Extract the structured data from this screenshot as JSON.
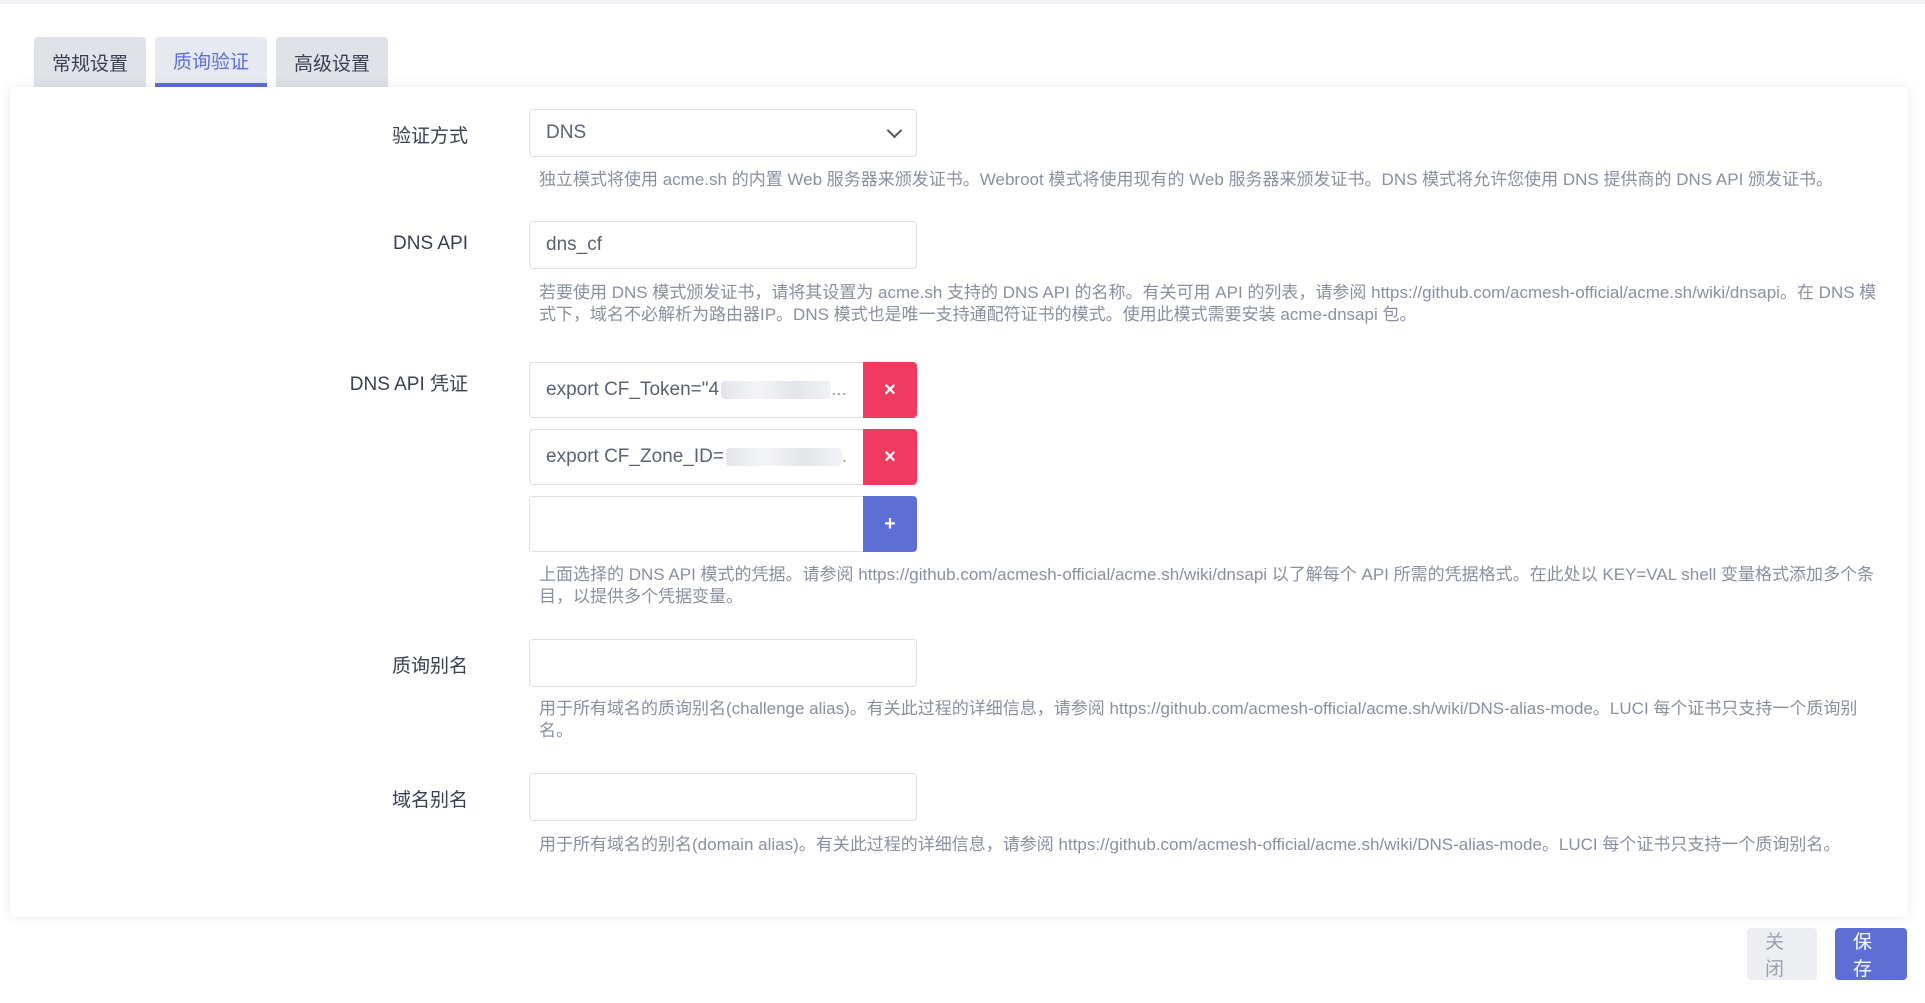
{
  "tabs": [
    {
      "label": "常规设置",
      "active": false
    },
    {
      "label": "质询验证",
      "active": true
    },
    {
      "label": "高级设置",
      "active": false
    }
  ],
  "form": {
    "validation_method": {
      "label": "验证方式",
      "value": "DNS",
      "help": "独立模式将使用 acme.sh 的内置 Web 服务器来颁发证书。Webroot 模式将使用现有的 Web 服务器来颁发证书。DNS 模式将允许您使用 DNS 提供商的 DNS API 颁发证书。"
    },
    "dns_api": {
      "label": "DNS API",
      "value": "dns_cf",
      "help": "若要使用 DNS 模式颁发证书，请将其设置为 acme.sh 支持的 DNS API 的名称。有关可用 API 的列表，请参阅 https://github.com/acmesh-official/acme.sh/wiki/dnsapi。在 DNS 模式下，域名不必解析为路由器IP。DNS 模式也是唯一支持通配符证书的模式。使用此模式需要安装 acme-dnsapi 包。"
    },
    "dns_credentials": {
      "label": "DNS API 凭证",
      "items": [
        {
          "value": "export CF_Token=\"4",
          "suffix": "..."
        },
        {
          "value": "export CF_Zone_ID=",
          "suffix": "."
        }
      ],
      "new_value": "",
      "remove_symbol": "×",
      "add_symbol": "+",
      "help": "上面选择的 DNS API 模式的凭据。请参阅 https://github.com/acmesh-official/acme.sh/wiki/dnsapi 以了解每个 API 所需的凭据格式。在此处以 KEY=VAL shell 变量格式添加多个条目，以提供多个凭据变量。"
    },
    "challenge_alias": {
      "label": "质询别名",
      "value": "",
      "help": "用于所有域名的质询别名(challenge alias)。有关此过程的详细信息，请参阅 https://github.com/acmesh-official/acme.sh/wiki/DNS-alias-mode。LUCI 每个证书只支持一个质询别名。"
    },
    "domain_alias": {
      "label": "域名别名",
      "value": "",
      "help": "用于所有域名的别名(domain alias)。有关此过程的详细信息，请参阅 https://github.com/acmesh-official/acme.sh/wiki/DNS-alias-mode。LUCI 每个证书只支持一个质询别名。"
    }
  },
  "footer": {
    "close_label": "关闭",
    "save_label": "保存"
  },
  "colors": {
    "accent": "#5d6ed6",
    "danger": "#f03a5f"
  }
}
